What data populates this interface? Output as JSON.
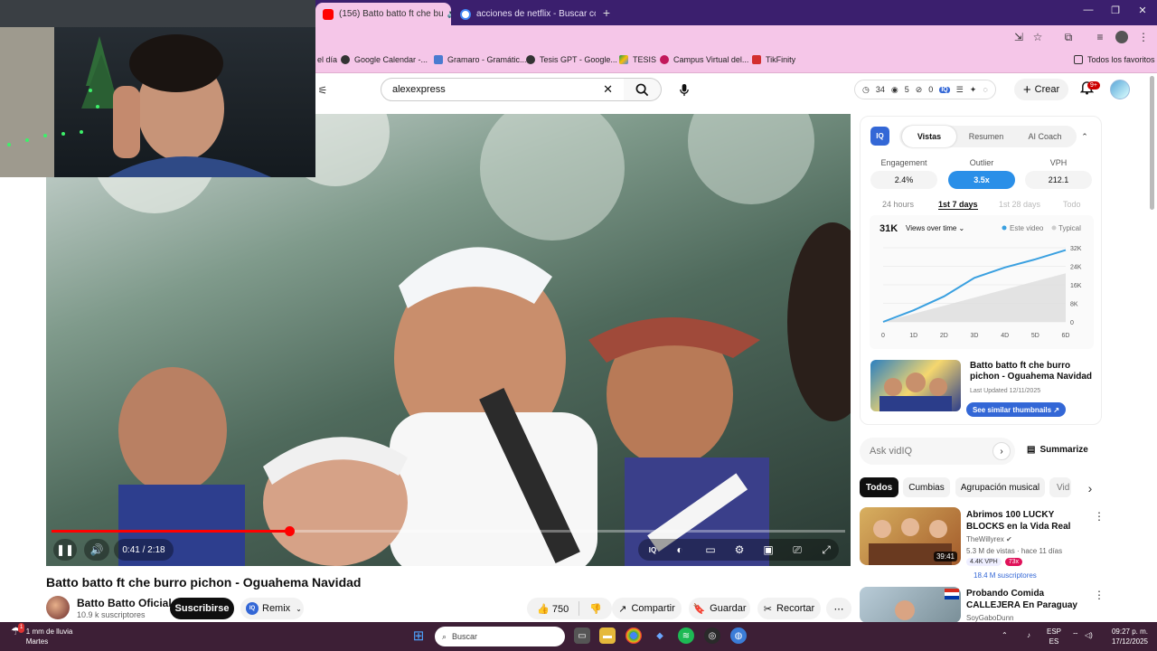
{
  "browser": {
    "tabs": [
      {
        "title": "(156) Batto batto ft che bu",
        "active": true
      },
      {
        "title": "acciones de netflix - Buscar con",
        "active": false
      }
    ],
    "tab_close": "✕",
    "new_tab": "+",
    "window_controls": [
      "—",
      "❐",
      "✕"
    ]
  },
  "bookmarks": [
    {
      "label": "el día"
    },
    {
      "label": "Google Calendar -..."
    },
    {
      "label": "Gramaro - Gramátic..."
    },
    {
      "label": "Tesis GPT - Google..."
    },
    {
      "label": "TESIS"
    },
    {
      "label": "Campus Virtual del..."
    },
    {
      "label": "TikFinity"
    },
    {
      "label": "Todos los favoritos"
    }
  ],
  "youtube": {
    "search_value": "alexexpress",
    "search_clear": "✕",
    "stats": {
      "views": "34",
      "eye": "5",
      "zero": "0"
    },
    "create_label": "Crear",
    "notif_badge": "9+"
  },
  "player": {
    "time": "0:41 / 2:18",
    "progress_fraction": 0.3,
    "title": "Batto batto ft che burro pichon - Oguahema Navidad",
    "channel": "Batto Batto Oficial",
    "subscribers": "10.9 k suscriptores",
    "subscribe_label": "Suscribirse",
    "remix_label": "Remix",
    "likes": "750",
    "share_label": "Compartir",
    "save_label": "Guardar",
    "clip_label": "Recortar",
    "more_label": "⋯"
  },
  "vidiq": {
    "logo": "IQ",
    "tabs": [
      "Vistas",
      "Resumen",
      "AI Coach"
    ],
    "metrics": [
      {
        "label": "Engagement",
        "value": "2.4%"
      },
      {
        "label": "Outlier",
        "value": "3.5x"
      },
      {
        "label": "VPH",
        "value": "212.1"
      }
    ],
    "ranges": [
      "24 hours",
      "1st 7 days",
      "1st 28 days",
      "Todo"
    ],
    "chart_header": {
      "total": "31K",
      "selector": "Views over time ⌄",
      "legend_this": "Este video",
      "legend_typical": "Typical"
    },
    "video_title": "Batto batto ft che burro pichon - Oguahema Navidad",
    "last_updated": "Last Updated 12/11/2025",
    "similar_label": "See similar thumbnails ↗",
    "ask_placeholder": "Ask vidIQ",
    "summarize_label": "Summarize"
  },
  "chart_data": {
    "type": "area",
    "x": [
      "0",
      "1D",
      "2D",
      "3D",
      "4D",
      "5D",
      "6D"
    ],
    "y_ticks": [
      "32K",
      "24K",
      "16K",
      "8K",
      "0"
    ],
    "ylim": [
      0,
      32000
    ],
    "series": [
      {
        "name": "Este video",
        "values": [
          0,
          5000,
          11000,
          19000,
          23500,
          27000,
          31000
        ],
        "color": "#3aa0e0"
      },
      {
        "name": "Typical",
        "values": [
          0,
          3500,
          7000,
          10500,
          14000,
          17500,
          21000
        ],
        "color": "#dddddd"
      }
    ]
  },
  "chips": [
    "Todos",
    "Cumbias",
    "Agrupación musical",
    "Vid"
  ],
  "recommendations": [
    {
      "title": "Abrimos 100 LUCKY BLOCKS en la Vida Real",
      "channel": "TheWillyrex ✔",
      "meta": "5.3 M de vistas · hace 11 días",
      "duration": "39:41",
      "vph": "4.4K VPH",
      "outlier": "73x",
      "subs": "18.4 M suscriptores"
    },
    {
      "title": "Probando Comida CALLEJERA En Paraguay",
      "channel": "SoyGaboDunn"
    }
  ],
  "taskbar": {
    "weather_temp": "1 mm de lluvia",
    "weather_day": "Martes",
    "search_label": "Buscar",
    "lang": "ESP",
    "lang2": "ES",
    "time": "09:27 p. m.",
    "date": "17/12/2025",
    "weather_badge": "1"
  },
  "colors": {
    "tabbar": "#3b1f6e",
    "toolbar": "#f5c6e8",
    "accent": "#3367d6",
    "youtube_red": "#ff0000",
    "taskbar": "#3d1f36"
  }
}
